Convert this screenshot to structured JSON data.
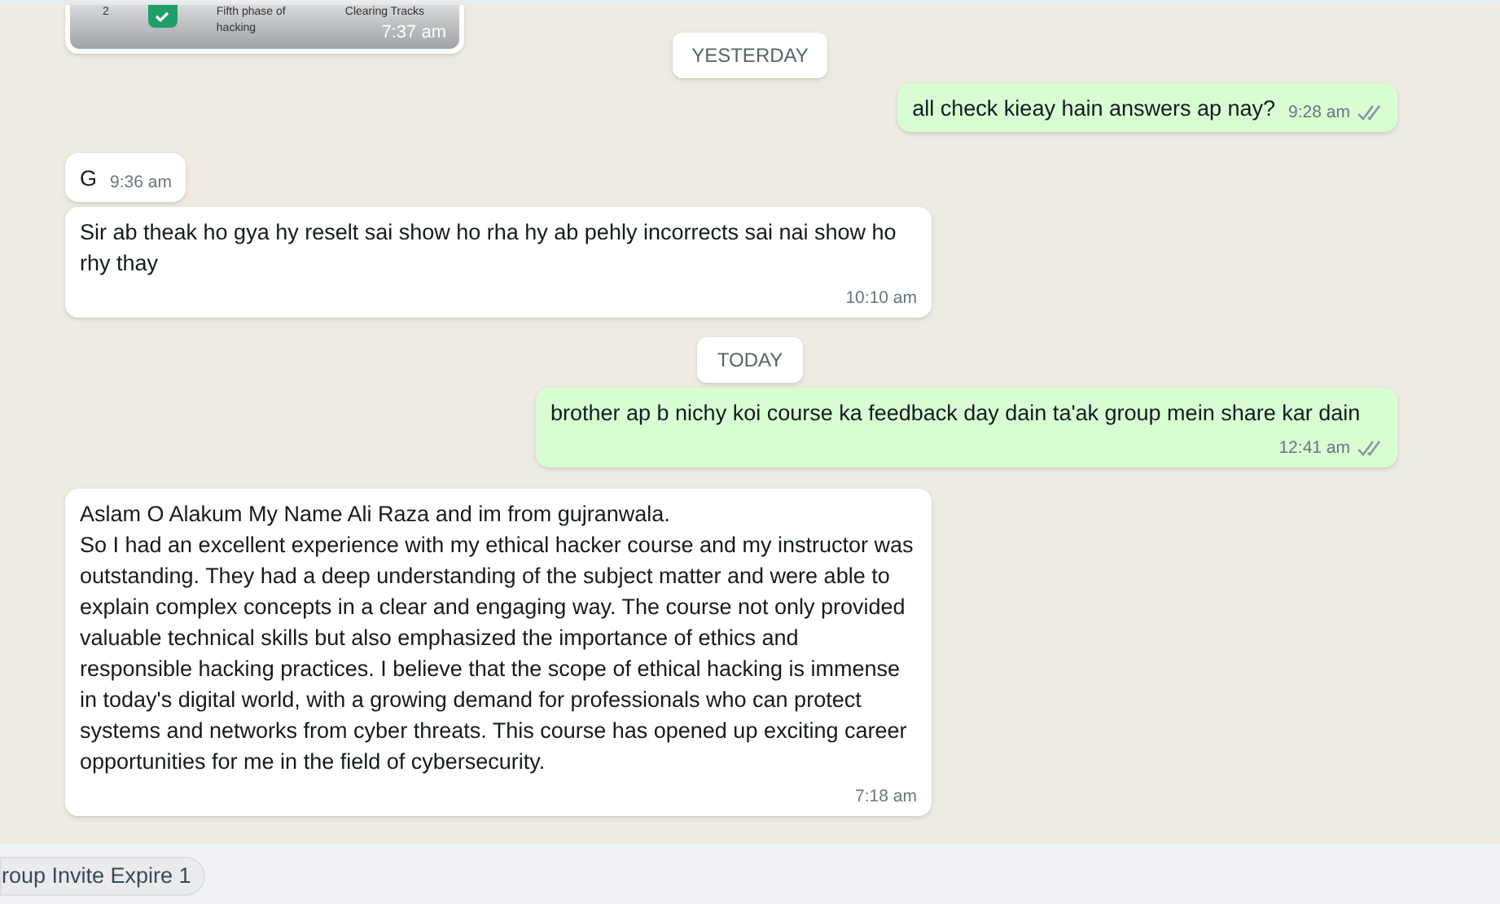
{
  "messages": [
    {
      "kind": "image",
      "outgoing": false,
      "time": "7:37 am",
      "rows": [
        {
          "number": "2",
          "checked": true,
          "phase": "Fifth phase of hacking",
          "name": "Clearing Tracks"
        }
      ]
    },
    {
      "kind": "date",
      "label": "YESTERDAY"
    },
    {
      "kind": "text",
      "outgoing": true,
      "text": "all check kieay hain answers ap nay?",
      "time": "9:28 am",
      "read": false
    },
    {
      "kind": "text",
      "outgoing": false,
      "text": "G",
      "time": "9:36 am"
    },
    {
      "kind": "text",
      "outgoing": false,
      "text": "Sir ab theak ho gya hy reselt sai show ho rha hy ab pehly incorrects sai nai show ho rhy thay",
      "time": "10:10 am"
    },
    {
      "kind": "date",
      "label": "TODAY"
    },
    {
      "kind": "text",
      "outgoing": true,
      "text": "brother ap b nichy koi course ka feedback day dain ta'ak group mein share kar dain",
      "time": "12:41 am",
      "read": false
    },
    {
      "kind": "text",
      "outgoing": false,
      "text": "Aslam O Alakum My Name Ali Raza and im from gujranwala.\nSo I had an excellent experience with my ethical hacker course and my instructor was outstanding. They had a deep understanding of the subject matter and were able to explain complex concepts in a clear and engaging way. The course not only provided valuable technical skills but also emphasized the importance of ethics and responsible hacking practices. I believe that the scope of ethical hacking is immense in today's digital world, with a growing demand for professionals who can protect systems and networks from cyber threats. This course has opened up exciting career opportunities for me in the field of cybersecurity.",
      "time": "7:18 am"
    }
  ],
  "footer": {
    "chips": [
      "roup Invite Expire 1"
    ]
  }
}
